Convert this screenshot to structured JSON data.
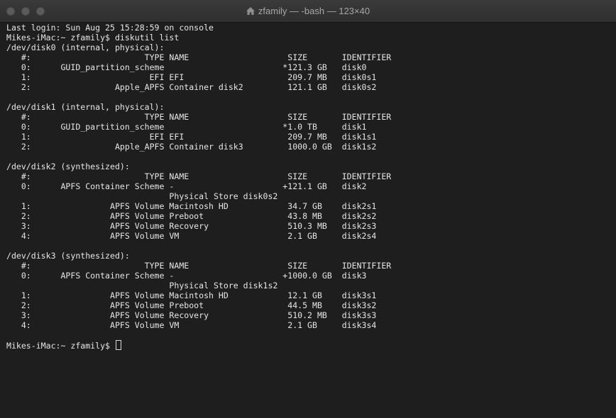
{
  "window": {
    "title": "zfamily — -bash — 123×40",
    "title_icon": "home-icon",
    "colors": {
      "background": "#1e1e1e",
      "text": "#e6e6e6",
      "titlebar": "#353535"
    }
  },
  "terminal": {
    "lines": [
      "Last login: Sun Aug 25 15:28:59 on console",
      "Mikes-iMac:~ zfamily$ diskutil list",
      "/dev/disk0 (internal, physical):",
      "   #:                       TYPE NAME                    SIZE       IDENTIFIER",
      "   0:      GUID_partition_scheme                        *121.3 GB   disk0",
      "   1:                        EFI EFI                     209.7 MB   disk0s1",
      "   2:                 Apple_APFS Container disk2         121.1 GB   disk0s2",
      "",
      "/dev/disk1 (internal, physical):",
      "   #:                       TYPE NAME                    SIZE       IDENTIFIER",
      "   0:      GUID_partition_scheme                        *1.0 TB     disk1",
      "   1:                        EFI EFI                     209.7 MB   disk1s1",
      "   2:                 Apple_APFS Container disk3         1000.0 GB  disk1s2",
      "",
      "/dev/disk2 (synthesized):",
      "   #:                       TYPE NAME                    SIZE       IDENTIFIER",
      "   0:      APFS Container Scheme -                      +121.1 GB   disk2",
      "                                 Physical Store disk0s2",
      "   1:                APFS Volume Macintosh HD            34.7 GB    disk2s1",
      "   2:                APFS Volume Preboot                 43.8 MB    disk2s2",
      "   3:                APFS Volume Recovery                510.3 MB   disk2s3",
      "   4:                APFS Volume VM                      2.1 GB     disk2s4",
      "",
      "/dev/disk3 (synthesized):",
      "   #:                       TYPE NAME                    SIZE       IDENTIFIER",
      "   0:      APFS Container Scheme -                      +1000.0 GB  disk3",
      "                                 Physical Store disk1s2",
      "   1:                APFS Volume Macintosh HD            12.1 GB    disk3s1",
      "   2:                APFS Volume Preboot                 44.5 MB    disk3s2",
      "   3:                APFS Volume Recovery                510.2 MB   disk3s3",
      "   4:                APFS Volume VM                      2.1 GB     disk3s4",
      ""
    ],
    "prompt": "Mikes-iMac:~ zfamily$ "
  }
}
